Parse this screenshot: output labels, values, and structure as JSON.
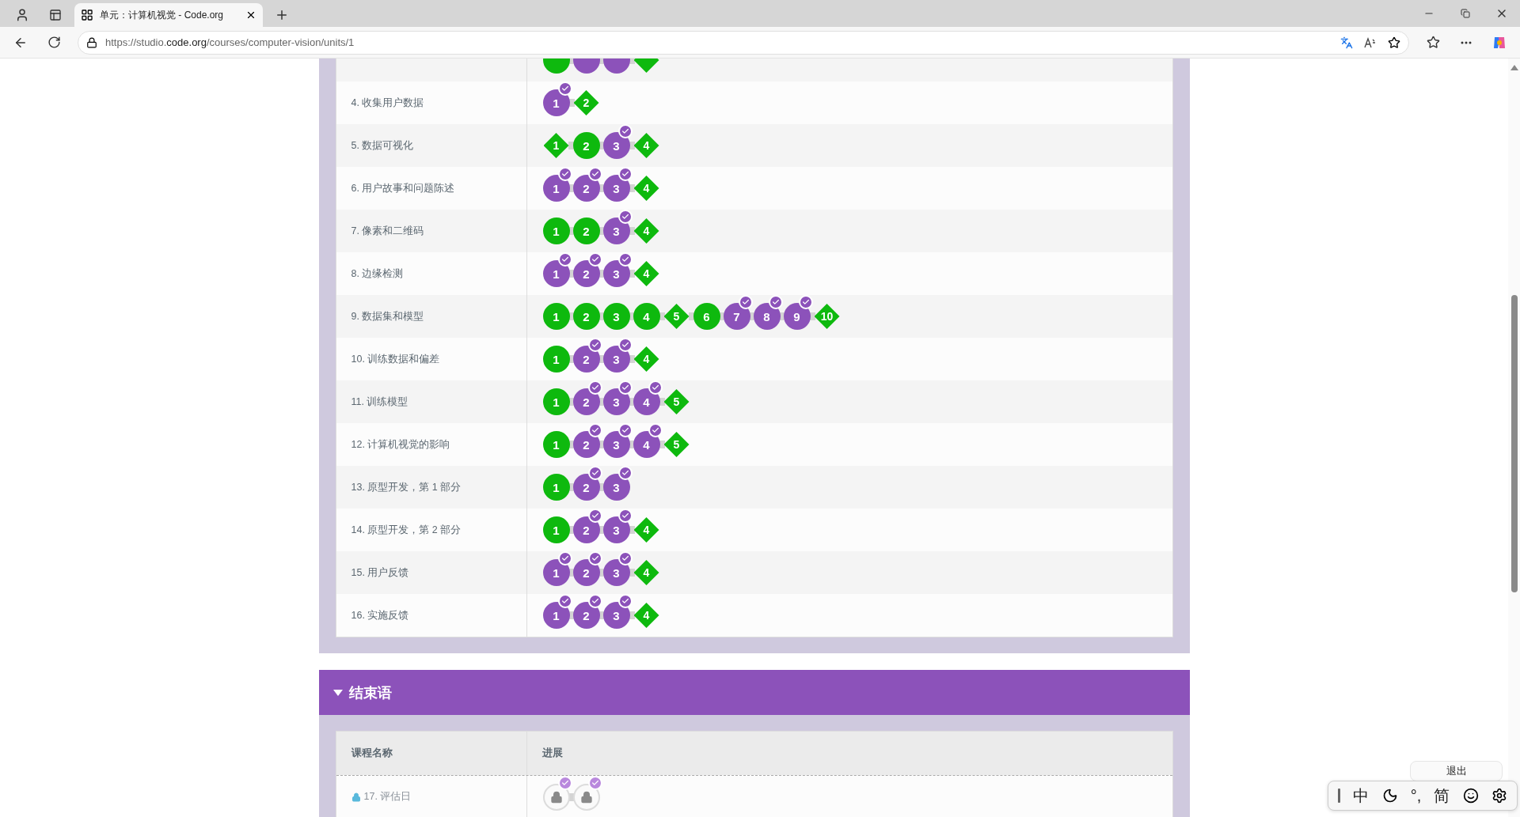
{
  "browser": {
    "tab_title": "单元：计算机视觉 - Code.org",
    "url_host": "https://studio.code.org",
    "url_path": "/courses/computer-vision/units/1"
  },
  "lessons": [
    {
      "bubbles": [
        {
          "kind": "circle",
          "completed": false
        },
        {
          "kind": "circle",
          "completed": true
        },
        {
          "kind": "circle",
          "completed": true
        },
        {
          "kind": "diamond",
          "completed": false
        }
      ]
    },
    {
      "name": "4. 收集用户数据",
      "bubbles": [
        {
          "label": "1",
          "kind": "circle",
          "completed": true
        },
        {
          "label": "2",
          "kind": "diamond",
          "completed": false
        }
      ]
    },
    {
      "name": "5. 数据可视化",
      "bubbles": [
        {
          "label": "1",
          "kind": "diamond",
          "completed": false
        },
        {
          "label": "2",
          "kind": "circle",
          "completed": false
        },
        {
          "label": "3",
          "kind": "circle",
          "completed": true
        },
        {
          "label": "4",
          "kind": "diamond",
          "completed": false
        }
      ]
    },
    {
      "name": "6. 用户故事和问题陈述",
      "bubbles": [
        {
          "label": "1",
          "kind": "circle",
          "completed": true
        },
        {
          "label": "2",
          "kind": "circle",
          "completed": true
        },
        {
          "label": "3",
          "kind": "circle",
          "completed": true
        },
        {
          "label": "4",
          "kind": "diamond",
          "completed": false
        }
      ]
    },
    {
      "name": "7. 像素和二维码",
      "bubbles": [
        {
          "label": "1",
          "kind": "circle",
          "completed": false
        },
        {
          "label": "2",
          "kind": "circle",
          "completed": false
        },
        {
          "label": "3",
          "kind": "circle",
          "completed": true
        },
        {
          "label": "4",
          "kind": "diamond",
          "completed": false
        }
      ]
    },
    {
      "name": "8. 边缘检测",
      "bubbles": [
        {
          "label": "1",
          "kind": "circle",
          "completed": true
        },
        {
          "label": "2",
          "kind": "circle",
          "completed": true
        },
        {
          "label": "3",
          "kind": "circle",
          "completed": true
        },
        {
          "label": "4",
          "kind": "diamond",
          "completed": false
        }
      ]
    },
    {
      "name": "9. 数据集和模型",
      "bubbles": [
        {
          "label": "1",
          "kind": "circle",
          "completed": false
        },
        {
          "label": "2",
          "kind": "circle",
          "completed": false
        },
        {
          "label": "3",
          "kind": "circle",
          "completed": false
        },
        {
          "label": "4",
          "kind": "circle",
          "completed": false
        },
        {
          "label": "5",
          "kind": "diamond",
          "completed": false
        },
        {
          "label": "6",
          "kind": "circle",
          "completed": false
        },
        {
          "label": "7",
          "kind": "circle",
          "completed": true
        },
        {
          "label": "8",
          "kind": "circle",
          "completed": true
        },
        {
          "label": "9",
          "kind": "circle",
          "completed": true
        },
        {
          "label": "10",
          "kind": "diamond",
          "completed": false
        }
      ]
    },
    {
      "name": "10. 训练数据和偏差",
      "bubbles": [
        {
          "label": "1",
          "kind": "circle",
          "completed": false
        },
        {
          "label": "2",
          "kind": "circle",
          "completed": true
        },
        {
          "label": "3",
          "kind": "circle",
          "completed": true
        },
        {
          "label": "4",
          "kind": "diamond",
          "completed": false
        }
      ]
    },
    {
      "name": "11. 训练模型",
      "bubbles": [
        {
          "label": "1",
          "kind": "circle",
          "completed": false
        },
        {
          "label": "2",
          "kind": "circle",
          "completed": true
        },
        {
          "label": "3",
          "kind": "circle",
          "completed": true
        },
        {
          "label": "4",
          "kind": "circle",
          "completed": true
        },
        {
          "label": "5",
          "kind": "diamond",
          "completed": false
        }
      ]
    },
    {
      "name": "12. 计算机视觉的影响",
      "bubbles": [
        {
          "label": "1",
          "kind": "circle",
          "completed": false
        },
        {
          "label": "2",
          "kind": "circle",
          "completed": true
        },
        {
          "label": "3",
          "kind": "circle",
          "completed": true
        },
        {
          "label": "4",
          "kind": "circle",
          "completed": true
        },
        {
          "label": "5",
          "kind": "diamond",
          "completed": false
        }
      ]
    },
    {
      "name": "13. 原型开发，第 1 部分",
      "bubbles": [
        {
          "label": "1",
          "kind": "circle",
          "completed": false
        },
        {
          "label": "2",
          "kind": "circle",
          "completed": true
        },
        {
          "label": "3",
          "kind": "circle",
          "completed": true
        }
      ]
    },
    {
      "name": "14. 原型开发，第 2 部分",
      "bubbles": [
        {
          "label": "1",
          "kind": "circle",
          "completed": false
        },
        {
          "label": "2",
          "kind": "circle",
          "completed": true
        },
        {
          "label": "3",
          "kind": "circle",
          "completed": true
        },
        {
          "label": "4",
          "kind": "diamond",
          "completed": false
        }
      ]
    },
    {
      "name": "15. 用户反馈",
      "bubbles": [
        {
          "label": "1",
          "kind": "circle",
          "completed": true
        },
        {
          "label": "2",
          "kind": "circle",
          "completed": true
        },
        {
          "label": "3",
          "kind": "circle",
          "completed": true
        },
        {
          "label": "4",
          "kind": "diamond",
          "completed": false
        }
      ]
    },
    {
      "name": "16. 实施反馈",
      "bubbles": [
        {
          "label": "1",
          "kind": "circle",
          "completed": true
        },
        {
          "label": "2",
          "kind": "circle",
          "completed": true
        },
        {
          "label": "3",
          "kind": "circle",
          "completed": true
        },
        {
          "label": "4",
          "kind": "diamond",
          "completed": false
        }
      ]
    }
  ],
  "section": {
    "title": "结束语",
    "expanded": true,
    "columns": [
      "课程名称",
      "进展"
    ],
    "lessons": [
      {
        "name": "17. 评估日",
        "locked": true,
        "bubbles": [
          {
            "kind": "lock",
            "completed": true
          },
          {
            "kind": "lock",
            "completed": true
          }
        ]
      }
    ]
  },
  "overlay": {
    "exit_button": "退出",
    "ime": {
      "mode": "中",
      "punctuation": "°,",
      "script": "简"
    }
  }
}
